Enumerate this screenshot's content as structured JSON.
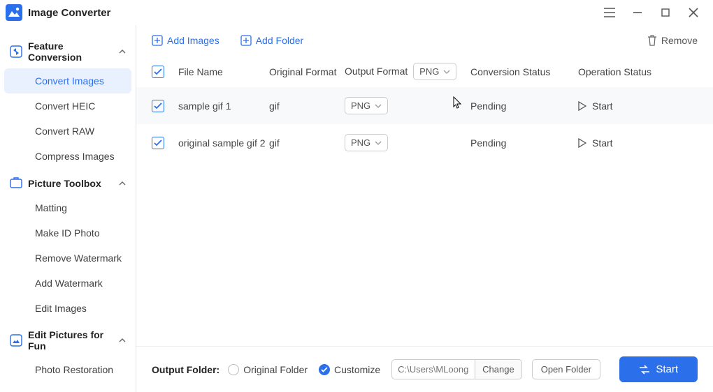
{
  "app_title": "Image Converter",
  "sidebar": {
    "groups": [
      {
        "label": "Feature Conversion",
        "items": [
          {
            "label": "Convert Images",
            "active": true
          },
          {
            "label": "Convert HEIC"
          },
          {
            "label": "Convert RAW"
          },
          {
            "label": "Compress Images"
          }
        ]
      },
      {
        "label": "Picture Toolbox",
        "items": [
          {
            "label": "Matting"
          },
          {
            "label": "Make ID Photo"
          },
          {
            "label": "Remove Watermark"
          },
          {
            "label": "Add Watermark"
          },
          {
            "label": "Edit Images"
          }
        ]
      },
      {
        "label": "Edit Pictures for Fun",
        "items": [
          {
            "label": "Photo Restoration"
          }
        ]
      }
    ]
  },
  "toolbar": {
    "add_images": "Add Images",
    "add_folder": "Add Folder",
    "remove": "Remove"
  },
  "table": {
    "headers": {
      "file_name": "File Name",
      "original_format": "Original Format",
      "output_format": "Output Format",
      "conversion_status": "Conversion Status",
      "operation_status": "Operation Status"
    },
    "header_output_value": "PNG",
    "rows": [
      {
        "name": "sample gif 1",
        "original": "gif",
        "output": "PNG",
        "conv_status": "Pending",
        "op_status": "Start"
      },
      {
        "name": "original sample gif 2",
        "original": "gif",
        "output": "PNG",
        "conv_status": "Pending",
        "op_status": "Start"
      }
    ]
  },
  "footer": {
    "label": "Output Folder:",
    "original_folder": "Original Folder",
    "customize": "Customize",
    "path_placeholder": "C:\\Users\\MLoong",
    "change": "Change",
    "open_folder": "Open Folder",
    "start": "Start"
  }
}
